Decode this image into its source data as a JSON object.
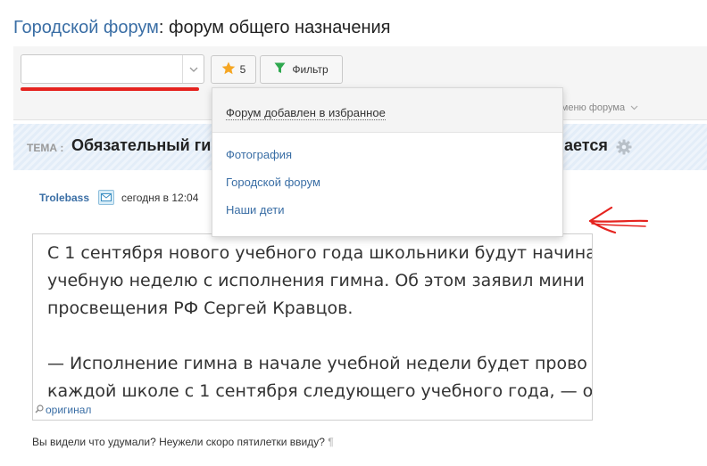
{
  "header": {
    "forum_link": "Городской форум",
    "subtitle": ": форум общего назначения"
  },
  "toolbar": {
    "forum_select_value": "",
    "favorites_count": "5",
    "filter_label": "Фильтр",
    "forum_menu_label": "ь меню форума"
  },
  "favorites_dropdown": {
    "header": "Форум добавлен в избранное",
    "items": [
      "Фотография",
      "Городской форум",
      "Наши дети"
    ]
  },
  "topic": {
    "label": "ТЕМА :",
    "title_visible": "Обязательный ги",
    "title_tail": "ается"
  },
  "post": {
    "author": "Trolebass",
    "date": "сегодня в 12:04",
    "quote_lines": [
      "С 1 сентября нового учебного года школьники будут начина",
      "учебную неделю с исполнения гимна. Об этом заявил мини",
      "просвещения РФ Сергей Кравцов.",
      "— Исполнение гимна в начале учебной недели будет прово",
      "каждой школе с 1 сентября следующего учебного года, — об"
    ],
    "source_link": "оригинал",
    "comment": "Вы видели что удумали? Неужели скоро пятилетки ввиду?",
    "pilcrow": "¶"
  },
  "colors": {
    "link": "#3a6ea5",
    "annotation_red": "#e5231f",
    "star": "#f5a623",
    "filter_green": "#2fa84f"
  }
}
